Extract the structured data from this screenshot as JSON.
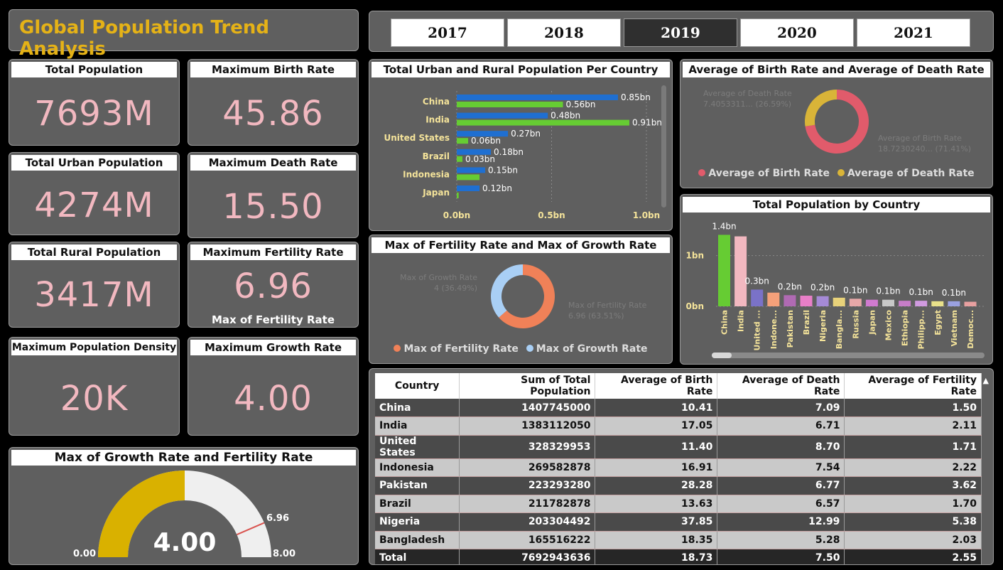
{
  "app_title": "Global Population Trend Analysis",
  "years": [
    {
      "label": "2017",
      "selected": false
    },
    {
      "label": "2018",
      "selected": false
    },
    {
      "label": "2019",
      "selected": true
    },
    {
      "label": "2020",
      "selected": false
    },
    {
      "label": "2021",
      "selected": false
    }
  ],
  "kpis": {
    "total_population": {
      "title": "Total Population",
      "value": "7693M"
    },
    "max_birth_rate": {
      "title": "Maximum Birth Rate",
      "value": "45.86"
    },
    "total_urban": {
      "title": "Total Urban Population",
      "value": "4274M"
    },
    "max_death_rate": {
      "title": "Maximum Death Rate",
      "value": "15.50"
    },
    "total_rural": {
      "title": "Total Rural Population",
      "value": "3417M"
    },
    "max_fertility": {
      "title": "Maximum Fertility Rate",
      "value": "6.96",
      "sub": "Max of Fertility Rate"
    },
    "max_density": {
      "title": "Maximum Population Density",
      "value": "20K"
    },
    "max_growth": {
      "title": "Maximum Growth Rate",
      "value": "4.00"
    }
  },
  "gauge": {
    "title": "Max of Growth Rate and Fertility Rate",
    "value_label": "4.00",
    "min_label": "0.00",
    "max_label": "8.00",
    "target_label": "6.96",
    "colors": {
      "fill": "#d9b100",
      "track": "#efefef",
      "target": "#d9534f"
    }
  },
  "chart_data": [
    {
      "type": "bar",
      "title": "Total Urban and Rural Population Per Country",
      "categories": [
        "China",
        "India",
        "United States",
        "Brazil",
        "Indonesia",
        "Japan"
      ],
      "series": [
        {
          "name": "Urban",
          "color": "#1f6fd1",
          "values": [
            0.85,
            0.48,
            0.27,
            0.18,
            0.15,
            0.12
          ],
          "labels": [
            "0.85bn",
            "0.48bn",
            "0.27bn",
            "0.18bn",
            "0.15bn",
            "0.12bn"
          ]
        },
        {
          "name": "Rural",
          "color": "#66cc33",
          "values": [
            0.56,
            0.91,
            0.06,
            0.03,
            0.12,
            0.01
          ],
          "labels": [
            "0.56bn",
            "0.91bn",
            "0.06bn",
            "0.03bn",
            "",
            ""
          ]
        }
      ],
      "xticks": [
        "0.0bn",
        "0.5bn",
        "1.0bn"
      ],
      "xlim": [
        0,
        1.0
      ]
    },
    {
      "type": "pie",
      "title": "Average of Birth Rate and Average of Death Rate",
      "slices": [
        {
          "name": "Average of Birth Rate",
          "value": 72.59,
          "color": "#e15b6b"
        },
        {
          "name": "Average of Death Rate",
          "value": 27.41,
          "color": "#d9b438"
        }
      ],
      "labels": [
        "Average of Death Rate",
        "7.4053311... (26.59%)",
        "Average of Birth Rate",
        "18.7230240... (71.41%)"
      ]
    },
    {
      "type": "pie",
      "title": "Max of Fertility Rate and Max of Growth Rate",
      "slices": [
        {
          "name": "Max of Fertility Rate",
          "value": 63.51,
          "color": "#f08158"
        },
        {
          "name": "Max of Growth Rate",
          "value": 36.49,
          "color": "#a9cff5"
        }
      ],
      "labels": [
        "Max of Growth Rate",
        "4 (36.49%)",
        "Max of Fertility Rate",
        "6.96 (63.51%)"
      ]
    },
    {
      "type": "bar",
      "title": "Total Population by Country",
      "categories": [
        "China",
        "India",
        "United ...",
        "Indone...",
        "Pakistan",
        "Brazil",
        "Nigeria",
        "Bangla...",
        "Russia",
        "Japan",
        "Mexico",
        "Ethiopia",
        "Philipp...",
        "Egypt",
        "Vietnam",
        "Democ..."
      ],
      "values": [
        1.41,
        1.38,
        0.33,
        0.27,
        0.22,
        0.21,
        0.2,
        0.17,
        0.15,
        0.13,
        0.13,
        0.11,
        0.11,
        0.1,
        0.1,
        0.09
      ],
      "colors": [
        "#66cc33",
        "#f2b8c0",
        "#7a72c8",
        "#f4a07a",
        "#b06ab3",
        "#e87fc8",
        "#a58ad6",
        "#e8d27a",
        "#e8a8a8",
        "#d07ad0",
        "#c8c8c8",
        "#c77dc8",
        "#d09ae0",
        "#e8e08a",
        "#9aa0e0",
        "#e8a0a0"
      ],
      "labels": [
        "1.4bn",
        "",
        "0.3bn",
        "",
        "0.2bn",
        "",
        "0.2bn",
        "",
        "0.1bn",
        "",
        "0.1bn",
        "",
        "0.1bn",
        "",
        "0.1bn",
        ""
      ],
      "yticks": [
        "0bn",
        "1bn"
      ],
      "ylim": [
        0,
        1.5
      ]
    }
  ],
  "table": {
    "headers": [
      "Country",
      "Sum of Total Population",
      "Average of Birth Rate",
      "Average of Death Rate",
      "Average of Fertility Rate"
    ],
    "rows": [
      [
        "China",
        "1407745000",
        "10.41",
        "7.09",
        "1.50"
      ],
      [
        "India",
        "1383112050",
        "17.05",
        "6.71",
        "2.11"
      ],
      [
        "United States",
        "328329953",
        "11.40",
        "8.70",
        "1.71"
      ],
      [
        "Indonesia",
        "269582878",
        "16.91",
        "7.54",
        "2.22"
      ],
      [
        "Pakistan",
        "223293280",
        "28.28",
        "6.77",
        "3.62"
      ],
      [
        "Brazil",
        "211782878",
        "13.63",
        "6.57",
        "1.70"
      ],
      [
        "Nigeria",
        "203304492",
        "37.85",
        "12.99",
        "5.38"
      ],
      [
        "Bangladesh",
        "165516222",
        "18.35",
        "5.28",
        "2.03"
      ]
    ],
    "total": [
      "Total",
      "7692943636",
      "18.73",
      "7.50",
      "2.55"
    ]
  }
}
